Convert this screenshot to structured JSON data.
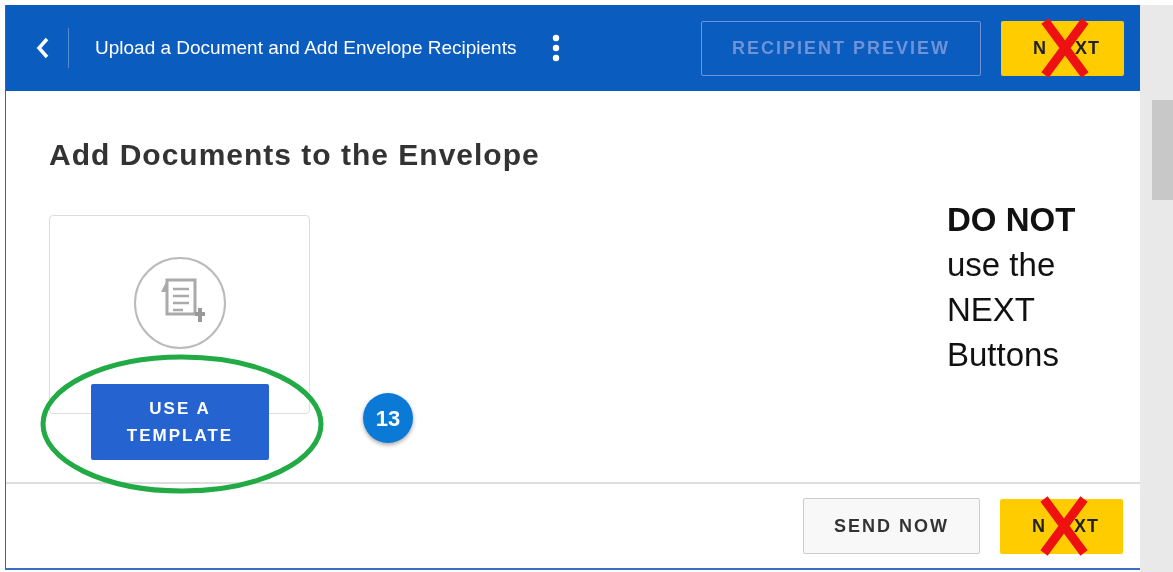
{
  "header": {
    "title": "Upload a Document and Add Envelope Recipients",
    "buttons": [
      {
        "label": "RECIPIENT PREVIEW",
        "kind": "outline",
        "crossed_out": false
      },
      {
        "label": "N XT",
        "kind": "primary",
        "crossed_out": true
      }
    ]
  },
  "heading": "Add Documents to the Envelope",
  "tile": {
    "button": "USE A TEMPLATE",
    "circled": true
  },
  "step_badge": "13",
  "note": "**DO NOT** use the NEXT Buttons",
  "footer": {
    "buttons": [
      {
        "label": "SEND NOW",
        "kind": "secondary",
        "crossed_out": false
      },
      {
        "label": "N XT",
        "kind": "primary",
        "crossed_out": true
      }
    ]
  }
}
